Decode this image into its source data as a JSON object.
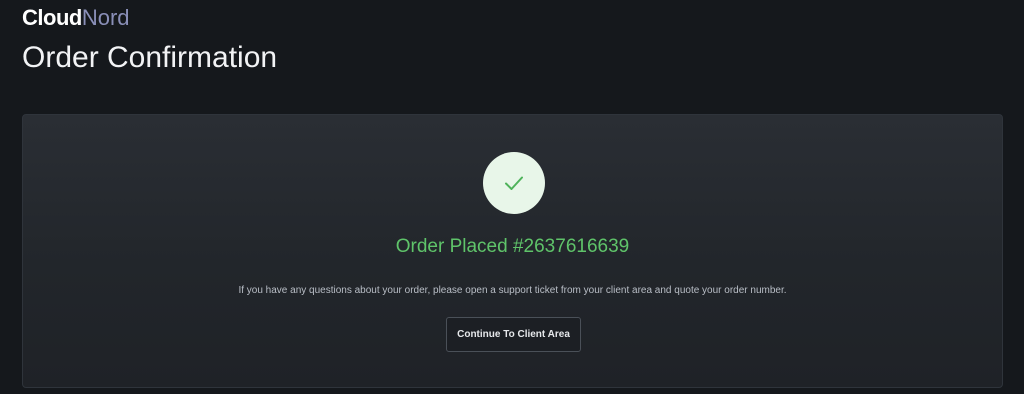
{
  "brand": {
    "logo_part1": "Cloud",
    "logo_part2": "Nord"
  },
  "header": {
    "title": "Order Confirmation"
  },
  "confirmation": {
    "status_prefix": "Order Placed",
    "order_number": "#2637616639",
    "message": "If you have any questions about your order, please open a support ticket from your client area and quote your order number.",
    "continue_label": "Continue To Client Area",
    "success_icon": "check-icon"
  },
  "colors": {
    "background": "#15181c",
    "success_green": "#5fc46a",
    "icon_circle": "#e8f6e9",
    "logo_accent": "#8a8fb8"
  }
}
